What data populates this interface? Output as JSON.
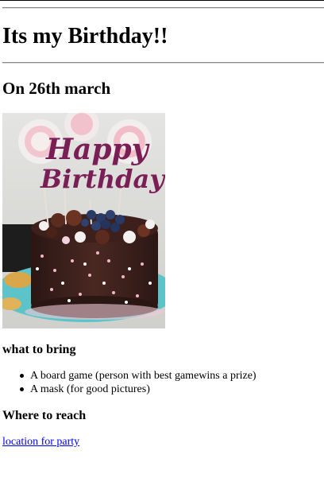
{
  "page": {
    "title": "Its my Birthday!!",
    "subtitle": "On 26th march"
  },
  "cake_image": {
    "alt": "Chocolate birthday cake with a \"Happy Birthday\" topper",
    "topper_line1": "Happy",
    "topper_line2": "Birthday"
  },
  "bring": {
    "heading": "what to bring",
    "items": [
      "A board game (person with best gamewins a prize)",
      "A mask (for good pictures)"
    ]
  },
  "reach": {
    "heading": "Where to reach",
    "link_text": "location for party"
  },
  "colors": {
    "link": "#0000ee",
    "rule": "#8a8a8a",
    "cake_icing": "#3b1f1a",
    "cake_plate": "#4fc2c9",
    "topper": "#7a1f55"
  }
}
